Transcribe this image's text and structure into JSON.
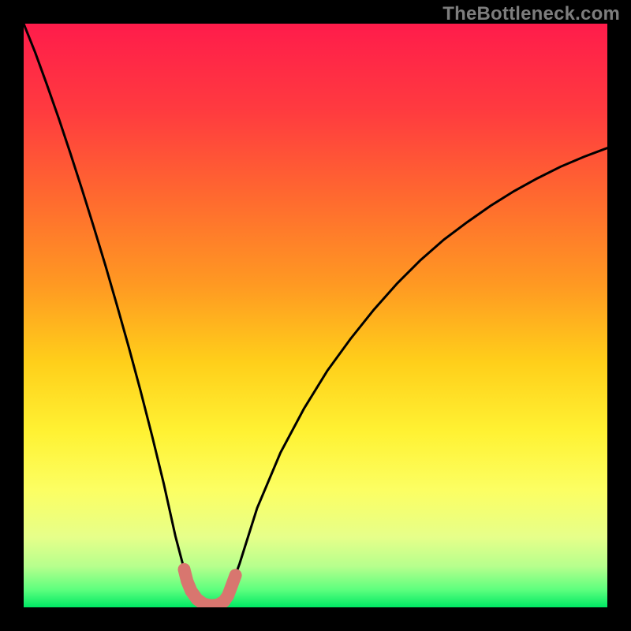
{
  "watermark": "TheBottleneck.com",
  "chart_data": {
    "type": "line",
    "title": "",
    "xlabel": "",
    "ylabel": "",
    "xlim": [
      0,
      100
    ],
    "ylim": [
      0,
      100
    ],
    "x": [
      0,
      2,
      4,
      6,
      8,
      10,
      12,
      14,
      16,
      18,
      20,
      22,
      24,
      26,
      27.5,
      29,
      30.5,
      32,
      33.5,
      35,
      37,
      40,
      44,
      48,
      52,
      56,
      60,
      64,
      68,
      72,
      76,
      80,
      84,
      88,
      92,
      96,
      100
    ],
    "series": [
      {
        "name": "bottleneck-curve",
        "values": [
          100,
          95,
          89.5,
          83.8,
          77.8,
          71.6,
          65.2,
          58.6,
          51.7,
          44.6,
          37.2,
          29.4,
          21.2,
          12.2,
          6.5,
          3.0,
          1.2,
          0.5,
          0.5,
          2.0,
          7.5,
          17.0,
          26.5,
          34.0,
          40.5,
          46.0,
          51.0,
          55.5,
          59.5,
          63.0,
          66.0,
          68.8,
          71.3,
          73.5,
          75.5,
          77.2,
          78.7
        ]
      }
    ],
    "highlight": {
      "name": "balance-zone",
      "color": "#d8766f",
      "points": [
        {
          "x": 27.5,
          "y": 6.5
        },
        {
          "x": 28.0,
          "y": 4.5
        },
        {
          "x": 28.7,
          "y": 2.8
        },
        {
          "x": 29.7,
          "y": 1.4
        },
        {
          "x": 30.8,
          "y": 0.6
        },
        {
          "x": 32.0,
          "y": 0.3
        },
        {
          "x": 33.2,
          "y": 0.4
        },
        {
          "x": 34.3,
          "y": 1.0
        },
        {
          "x": 35.0,
          "y": 2.0
        },
        {
          "x": 35.6,
          "y": 3.6
        },
        {
          "x": 36.3,
          "y": 5.5
        }
      ]
    },
    "background": {
      "type": "vertical-gradient",
      "stops": [
        {
          "offset": 0.0,
          "color": "#ff1c4b"
        },
        {
          "offset": 0.15,
          "color": "#ff3b3f"
        },
        {
          "offset": 0.3,
          "color": "#ff6a2f"
        },
        {
          "offset": 0.45,
          "color": "#ff9a22"
        },
        {
          "offset": 0.58,
          "color": "#ffcf1a"
        },
        {
          "offset": 0.7,
          "color": "#fff233"
        },
        {
          "offset": 0.8,
          "color": "#fcff63"
        },
        {
          "offset": 0.88,
          "color": "#e6ff8a"
        },
        {
          "offset": 0.93,
          "color": "#b6ff8d"
        },
        {
          "offset": 0.97,
          "color": "#5dff7e"
        },
        {
          "offset": 1.0,
          "color": "#00e864"
        }
      ]
    }
  }
}
